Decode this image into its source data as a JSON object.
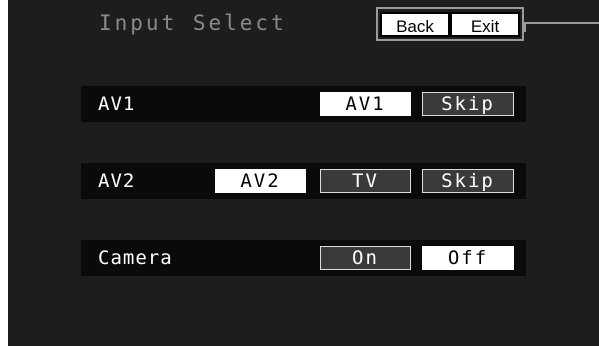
{
  "header": {
    "title": "Input Select",
    "back_label": "Back",
    "exit_label": "Exit"
  },
  "rows": [
    {
      "label": "AV1",
      "options": [
        {
          "label": "AV1",
          "selected": true
        },
        {
          "label": "Skip",
          "selected": false
        }
      ]
    },
    {
      "label": "AV2",
      "options": [
        {
          "label": "AV2",
          "selected": true
        },
        {
          "label": "TV",
          "selected": false
        },
        {
          "label": "Skip",
          "selected": false
        }
      ]
    },
    {
      "label": "Camera",
      "options": [
        {
          "label": "On",
          "selected": false
        },
        {
          "label": "Off",
          "selected": true
        }
      ]
    }
  ],
  "colors": {
    "screen_background": "#1d1d1d",
    "row_background": "#0a0a0a",
    "selected_option": "#ffffff",
    "unselected_option": "#3a3a3a",
    "title_text": "#8a8a8a"
  }
}
